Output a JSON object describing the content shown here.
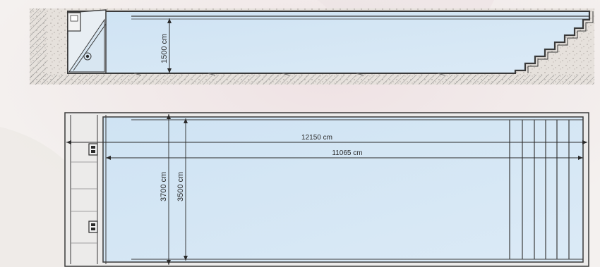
{
  "section_view": {
    "depth_label": "1500 cm"
  },
  "plan_view": {
    "overall_length_label": "12150 cm",
    "inner_length_label": "11065 cm",
    "overall_width_label": "3700 cm",
    "inner_width_label": "3500 cm"
  },
  "colors": {
    "water": "#d4e6f4",
    "outline": "#3a3a3a",
    "ground": "#e6e1dc",
    "background": "#f4f1ef"
  }
}
